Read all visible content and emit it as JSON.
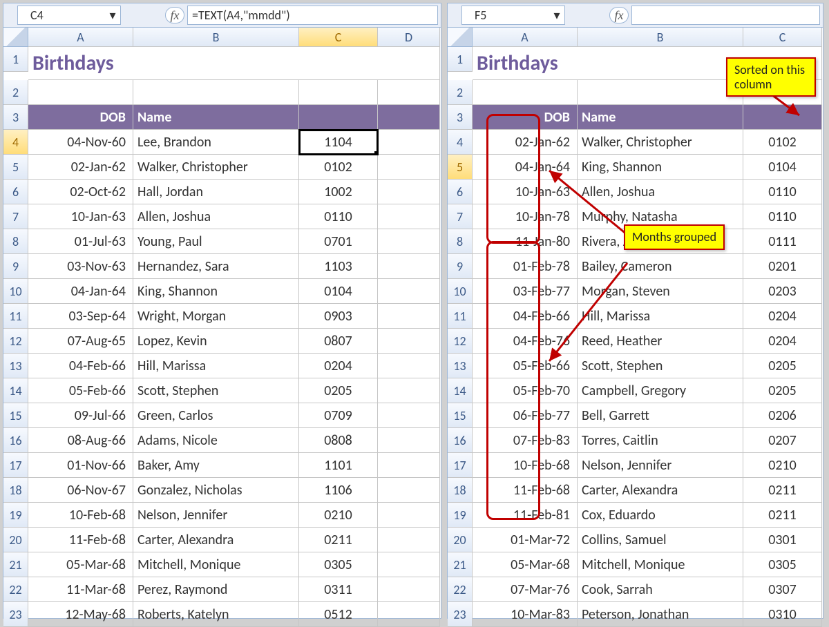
{
  "left": {
    "name_box": "C4",
    "formula": "=TEXT(A4,\"mmdd\")",
    "columns": [
      "A",
      "B",
      "C",
      "D"
    ],
    "title": "Birthdays",
    "headers": {
      "dob": "DOB",
      "name": "Name"
    },
    "selected_col_index": 2,
    "selected_row_index": 0,
    "rows": [
      {
        "r": 4,
        "dob": "04-Nov-60",
        "name": "Lee, Brandon",
        "code": "1104"
      },
      {
        "r": 5,
        "dob": "02-Jan-62",
        "name": "Walker, Christopher",
        "code": "0102"
      },
      {
        "r": 6,
        "dob": "02-Oct-62",
        "name": "Hall, Jordan",
        "code": "1002"
      },
      {
        "r": 7,
        "dob": "10-Jan-63",
        "name": "Allen, Joshua",
        "code": "0110"
      },
      {
        "r": 8,
        "dob": "01-Jul-63",
        "name": "Young, Paul",
        "code": "0701"
      },
      {
        "r": 9,
        "dob": "03-Nov-63",
        "name": "Hernandez, Sara",
        "code": "1103"
      },
      {
        "r": 10,
        "dob": "04-Jan-64",
        "name": "King, Shannon",
        "code": "0104"
      },
      {
        "r": 11,
        "dob": "03-Sep-64",
        "name": "Wright, Morgan",
        "code": "0903"
      },
      {
        "r": 12,
        "dob": "07-Aug-65",
        "name": "Lopez, Kevin",
        "code": "0807"
      },
      {
        "r": 13,
        "dob": "04-Feb-66",
        "name": "Hill, Marissa",
        "code": "0204"
      },
      {
        "r": 14,
        "dob": "05-Feb-66",
        "name": "Scott, Stephen",
        "code": "0205"
      },
      {
        "r": 15,
        "dob": "09-Jul-66",
        "name": "Green, Carlos",
        "code": "0709"
      },
      {
        "r": 16,
        "dob": "08-Aug-66",
        "name": "Adams, Nicole",
        "code": "0808"
      },
      {
        "r": 17,
        "dob": "01-Nov-66",
        "name": "Baker, Amy",
        "code": "1101"
      },
      {
        "r": 18,
        "dob": "06-Nov-67",
        "name": "Gonzalez, Nicholas",
        "code": "1106"
      },
      {
        "r": 19,
        "dob": "10-Feb-68",
        "name": "Nelson, Jennifer",
        "code": "0210"
      },
      {
        "r": 20,
        "dob": "11-Feb-68",
        "name": "Carter, Alexandra",
        "code": "0211"
      },
      {
        "r": 21,
        "dob": "05-Mar-68",
        "name": "Mitchell, Monique",
        "code": "0305"
      },
      {
        "r": 22,
        "dob": "11-Mar-68",
        "name": "Perez, Raymond",
        "code": "0311"
      },
      {
        "r": 23,
        "dob": "12-May-68",
        "name": "Roberts, Katelyn",
        "code": "0512"
      }
    ]
  },
  "right": {
    "name_box": "F5",
    "formula": "",
    "columns": [
      "A",
      "B",
      "C"
    ],
    "title": "Birthdays",
    "headers": {
      "dob": "DOB",
      "name": "Name"
    },
    "selected_row_index": 1,
    "rows": [
      {
        "r": 4,
        "dob": "02-Jan-62",
        "name": "Walker, Christopher",
        "code": "0102"
      },
      {
        "r": 5,
        "dob": "04-Jan-64",
        "name": "King, Shannon",
        "code": "0104"
      },
      {
        "r": 6,
        "dob": "10-Jan-63",
        "name": "Allen, Joshua",
        "code": "0110"
      },
      {
        "r": 7,
        "dob": "10-Jan-78",
        "name": "Murphy, Natasha",
        "code": "0110"
      },
      {
        "r": 8,
        "dob": "11-Jan-80",
        "name": "Rivera, Allison",
        "code": "0111"
      },
      {
        "r": 9,
        "dob": "01-Feb-78",
        "name": "Bailey, Cameron",
        "code": "0201"
      },
      {
        "r": 10,
        "dob": "03-Feb-77",
        "name": "Morgan, Steven",
        "code": "0203"
      },
      {
        "r": 11,
        "dob": "04-Feb-66",
        "name": "Hill, Marissa",
        "code": "0204"
      },
      {
        "r": 12,
        "dob": "04-Feb-76",
        "name": "Reed, Heather",
        "code": "0204"
      },
      {
        "r": 13,
        "dob": "05-Feb-66",
        "name": "Scott, Stephen",
        "code": "0205"
      },
      {
        "r": 14,
        "dob": "05-Feb-70",
        "name": "Campbell, Gregory",
        "code": "0205"
      },
      {
        "r": 15,
        "dob": "06-Feb-77",
        "name": "Bell, Garrett",
        "code": "0206"
      },
      {
        "r": 16,
        "dob": "07-Feb-83",
        "name": "Torres, Caitlin",
        "code": "0207"
      },
      {
        "r": 17,
        "dob": "10-Feb-68",
        "name": "Nelson, Jennifer",
        "code": "0210"
      },
      {
        "r": 18,
        "dob": "11-Feb-68",
        "name": "Carter, Alexandra",
        "code": "0211"
      },
      {
        "r": 19,
        "dob": "11-Feb-81",
        "name": "Cox, Eduardo",
        "code": "0211"
      },
      {
        "r": 20,
        "dob": "01-Mar-72",
        "name": "Collins, Samuel",
        "code": "0301"
      },
      {
        "r": 21,
        "dob": "05-Mar-68",
        "name": "Mitchell, Monique",
        "code": "0305"
      },
      {
        "r": 22,
        "dob": "07-Mar-76",
        "name": "Cook, Sarrah",
        "code": "0307"
      },
      {
        "r": 23,
        "dob": "10-Mar-83",
        "name": "Peterson, Jonathan",
        "code": "0310"
      }
    ],
    "callouts": {
      "sorted": "Sorted on this column",
      "grouped": "Months grouped"
    }
  },
  "glyph": {
    "fx": "fx",
    "dropdown": "▾"
  }
}
